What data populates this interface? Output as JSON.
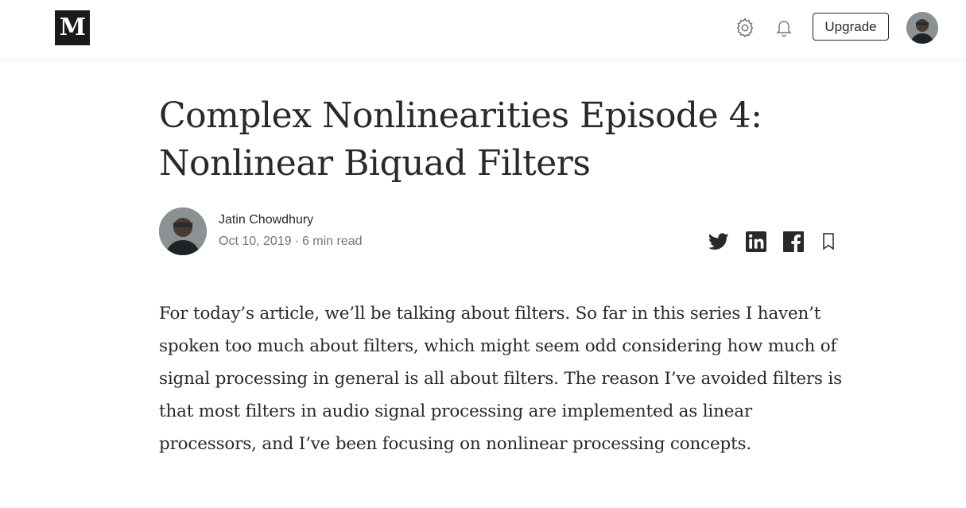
{
  "header": {
    "logo_text": "M",
    "upgrade_label": "Upgrade",
    "icons": [
      "gear-icon",
      "bell-icon"
    ]
  },
  "article": {
    "title": "Complex Nonlinearities Episode 4: Nonlinear Biquad Filters",
    "author": "Jatin Chowdhury",
    "date": "Oct 10, 2019",
    "separator": "·",
    "read_time": "6 min read",
    "share_icons": [
      "twitter-icon",
      "linkedin-icon",
      "facebook-icon",
      "bookmark-icon"
    ],
    "paragraph": "For today’s article, we’ll be talking about filters. So far in this series I haven’t spoken too much about filters, which might seem odd considering how much of signal processing in general is all about filters. The reason I’ve avoided filters is that most filters in audio signal processing are implemented as linear processors, and I’ve been focusing on nonlinear processing concepts."
  },
  "colors": {
    "text": "#292929",
    "muted": "#757575",
    "logo_bg": "#1a1a1a"
  }
}
